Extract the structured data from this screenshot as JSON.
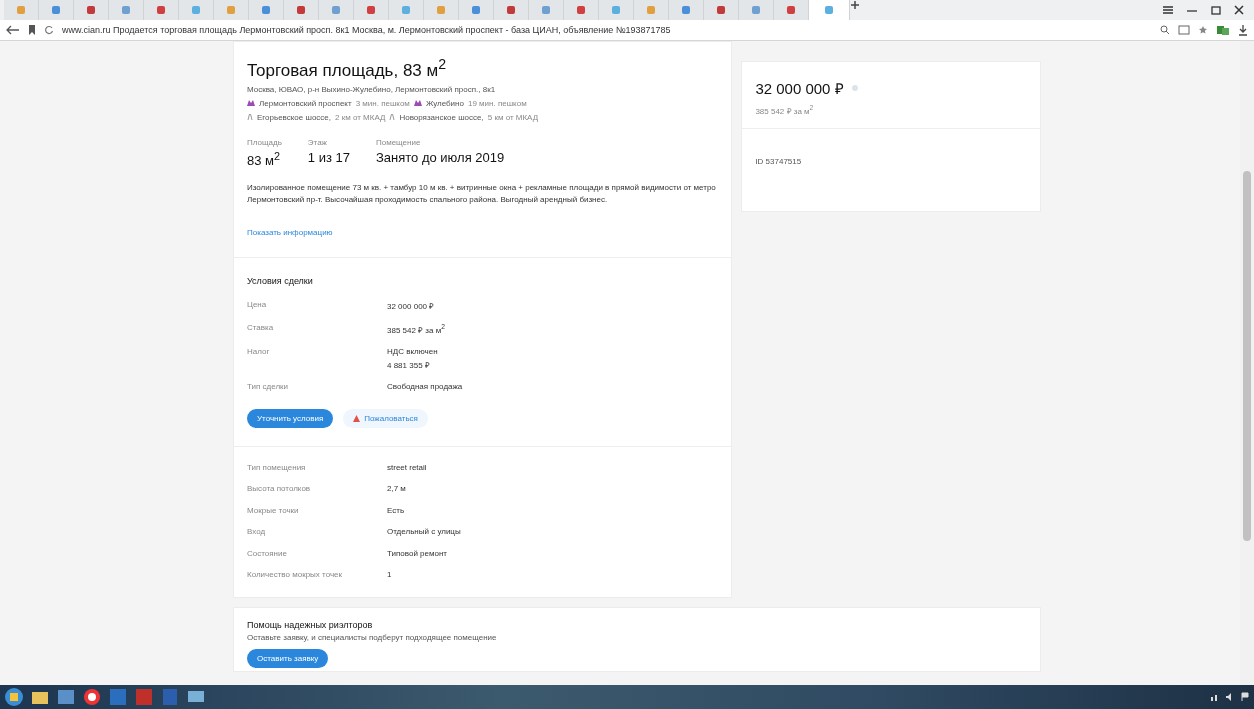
{
  "browser": {
    "tabs": [
      {
        "selected": false
      },
      {
        "selected": false
      },
      {
        "selected": false
      },
      {
        "selected": false
      },
      {
        "selected": false
      },
      {
        "selected": false
      },
      {
        "selected": false
      },
      {
        "selected": false
      },
      {
        "selected": false
      },
      {
        "selected": false
      },
      {
        "selected": false
      },
      {
        "selected": false
      },
      {
        "selected": false
      },
      {
        "selected": false
      },
      {
        "selected": false
      },
      {
        "selected": false
      },
      {
        "selected": false
      },
      {
        "selected": false
      },
      {
        "selected": false
      },
      {
        "selected": false
      },
      {
        "selected": false
      },
      {
        "selected": false
      },
      {
        "selected": false
      },
      {
        "selected": true
      }
    ],
    "address": "www.cian.ru  Продается торговая площадь Лермонтовский просп. 8к1 Москва, м. Лермонтовский проспект - база ЦИАН, объявление №193871785"
  },
  "listing": {
    "title": "Торговая площадь, 83 м$^{2}$",
    "address": "Москва, ЮВАО, р-н Выхино-Жулебино, Лермонтовский просп., 8к1",
    "metro": [
      {
        "station": "Лермонтовский проспект",
        "time": "3 мин. пешком"
      },
      {
        "station": "Жулебино",
        "time": "19 мин. пешком"
      }
    ],
    "highways": [
      {
        "name": "Егорьевское шоссе,",
        "distance": "2 км от МКАД"
      },
      {
        "name": "Новорязанское шоссе,",
        "distance": "5 км от МКАД"
      }
    ],
    "facts": [
      {
        "label": "Площадь",
        "value": "83 м$^{2}$"
      },
      {
        "label": "Этаж",
        "value": "1 из 17"
      },
      {
        "label": "Помещение",
        "value": "Занято до июля 2019"
      }
    ],
    "description": "Изолированное помещение 73 м кв. + тамбур 10 м кв. + витринные окна + рекламные площади в прямой видимости от метро Лермонтовский пр-т. Высочайшая проходимость спального района. Выгодный арендный бизнес.",
    "more_link": "Показать информацию",
    "deal": {
      "heading": "Условия сделки",
      "rows": [
        {
          "label": "Цена",
          "lines": [
            "32 000 000 ₽"
          ]
        },
        {
          "label": "Ставка",
          "lines": [
            "385 542 ₽ за м$^{2}$"
          ]
        },
        {
          "label": "Налог",
          "lines": [
            "НДС включен",
            "4 881 355 ₽"
          ]
        },
        {
          "label": "Тип сделки",
          "lines": [
            "Свободная продажа"
          ]
        }
      ]
    },
    "clarify_button": "Уточнить условия",
    "complain_button": "Пожаловаться",
    "details": [
      {
        "label": "Тип помещения",
        "value": "street retail"
      },
      {
        "label": "Высота потолков",
        "value": "2,7 м"
      },
      {
        "label": "Мокрые точки",
        "value": "Есть"
      },
      {
        "label": "Вход",
        "value": "Отдельный с улицы"
      },
      {
        "label": "Состояние",
        "value": "Типовой ремонт"
      },
      {
        "label": "Количество мокрых точек",
        "value": "1"
      }
    ]
  },
  "price_card": {
    "price": "32 000 000 ₽",
    "per_m2": "385 542 ₽ за м$^{2}$",
    "id": "ID 53747515"
  },
  "help": {
    "title": "Помощь надежных риэлторов",
    "text": "Оставьте заявку, и специалисты подберут подходящее помещение",
    "button": "Оставить заявку"
  }
}
